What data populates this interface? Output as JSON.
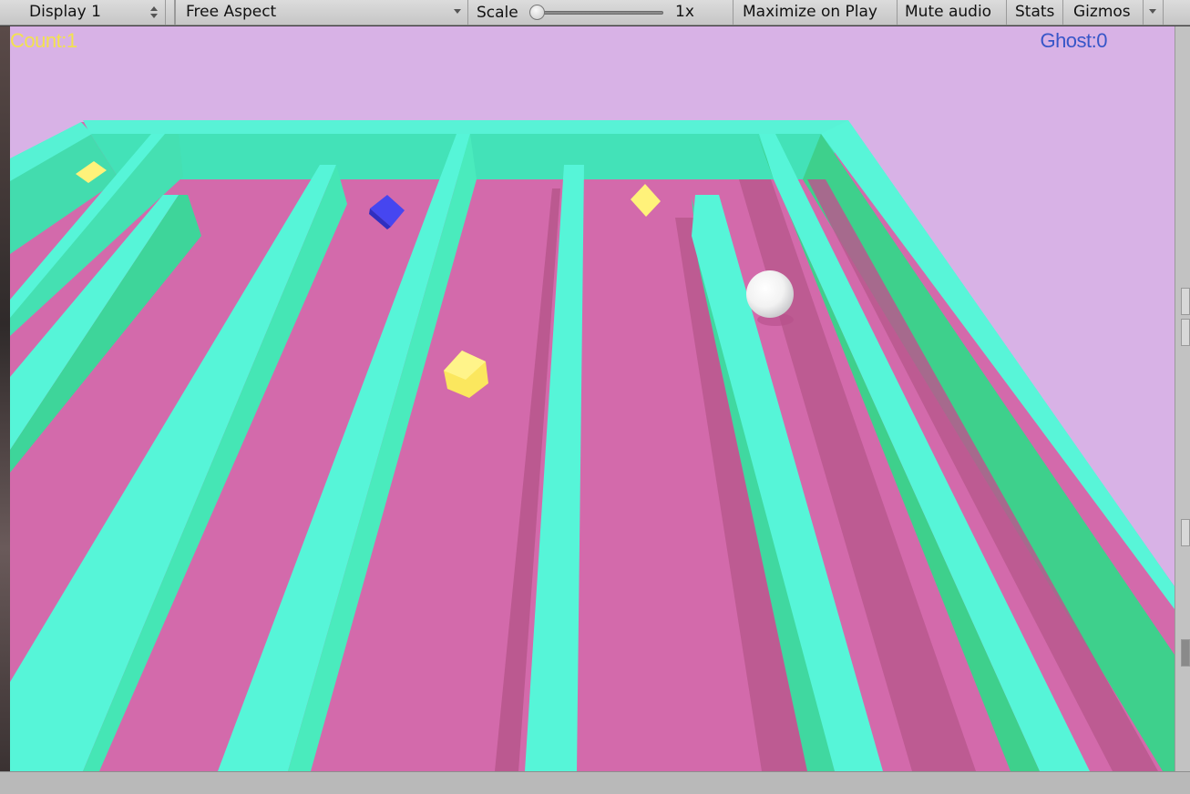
{
  "toolbar": {
    "display": "Display 1",
    "aspect": "Free Aspect",
    "scale_label": "Scale",
    "scale_value": "1x",
    "scale_slider_level": 0,
    "maximize": "Maximize on Play",
    "mute": "Mute audio",
    "stats": "Stats",
    "gizmos": "Gizmos"
  },
  "hud": {
    "count": "Count:1",
    "ghost": "Ghost:0"
  },
  "scene": {
    "sky_color": "#d8b2e6",
    "floor_color": "#d36aab",
    "wall_top_color": "#56f5d4",
    "wall_side_color": "#3dd08a",
    "player": "white-sphere",
    "pickups": "yellow-cubes",
    "ghost": "blue-cube"
  }
}
